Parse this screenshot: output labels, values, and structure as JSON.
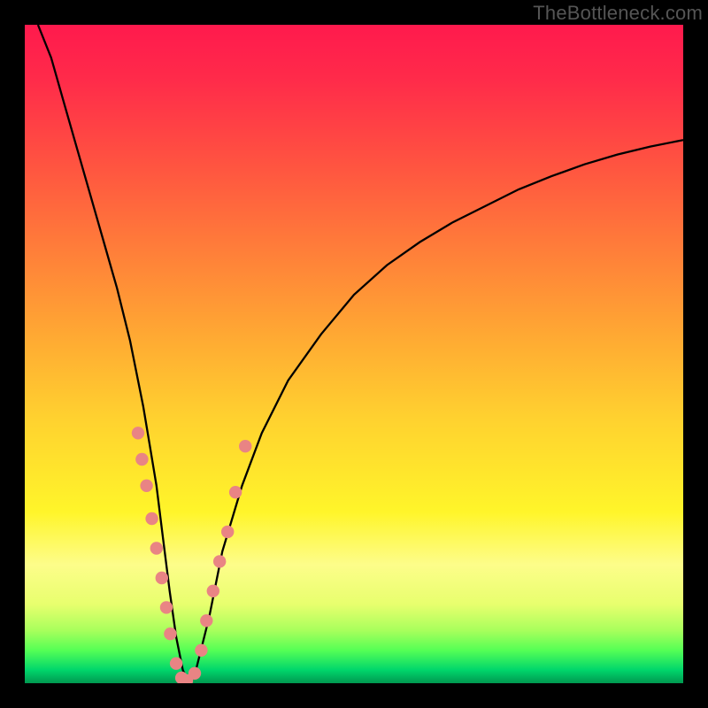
{
  "watermark": "TheBottleneck.com",
  "chart_data": {
    "type": "line",
    "title": "",
    "xlabel": "",
    "ylabel": "",
    "xlim": [
      0,
      100
    ],
    "ylim": [
      0,
      100
    ],
    "grid": false,
    "legend": false,
    "series": [
      {
        "name": "curve",
        "color": "#000000",
        "x_pct": [
          2,
          4,
          6,
          8,
          10,
          12,
          14,
          16,
          18,
          19,
          20,
          21,
          22,
          23,
          24,
          25,
          26,
          28,
          30,
          33,
          36,
          40,
          45,
          50,
          55,
          60,
          65,
          70,
          75,
          80,
          85,
          90,
          95,
          100
        ],
        "y_pct": [
          100,
          95,
          88,
          81,
          74,
          67,
          60,
          52,
          42,
          36,
          30,
          22,
          14,
          7,
          2,
          0,
          2,
          10,
          20,
          30,
          38,
          46,
          53,
          59,
          63.5,
          67,
          70,
          72.5,
          75,
          77,
          78.8,
          80.3,
          81.5,
          82.5
        ]
      },
      {
        "name": "points",
        "color": "#e98484",
        "x_pct": [
          17.2,
          17.8,
          18.5,
          19.3,
          20.0,
          20.8,
          21.5,
          22.1,
          23.0,
          23.8,
          24.6,
          25.8,
          26.8,
          27.6,
          28.6,
          29.6,
          30.8,
          32.0,
          33.5
        ],
        "y_pct": [
          38.0,
          34.0,
          30.0,
          25.0,
          20.5,
          16.0,
          11.5,
          7.5,
          3.0,
          0.8,
          0.4,
          1.5,
          5.0,
          9.5,
          14.0,
          18.5,
          23.0,
          29.0,
          36.0
        ]
      }
    ],
    "gradient_stops": [
      {
        "pct": 0,
        "color": "#ff1a4d"
      },
      {
        "pct": 8,
        "color": "#ff2a4a"
      },
      {
        "pct": 22,
        "color": "#ff5640"
      },
      {
        "pct": 33,
        "color": "#ff7a3a"
      },
      {
        "pct": 47,
        "color": "#ffa833"
      },
      {
        "pct": 60,
        "color": "#ffd22f"
      },
      {
        "pct": 74,
        "color": "#fff52a"
      },
      {
        "pct": 82,
        "color": "#fdfd8a"
      },
      {
        "pct": 88,
        "color": "#e8ff6e"
      },
      {
        "pct": 92,
        "color": "#a8ff5c"
      },
      {
        "pct": 95,
        "color": "#55ff55"
      },
      {
        "pct": 98,
        "color": "#00d66b"
      },
      {
        "pct": 100,
        "color": "#009850"
      }
    ]
  }
}
